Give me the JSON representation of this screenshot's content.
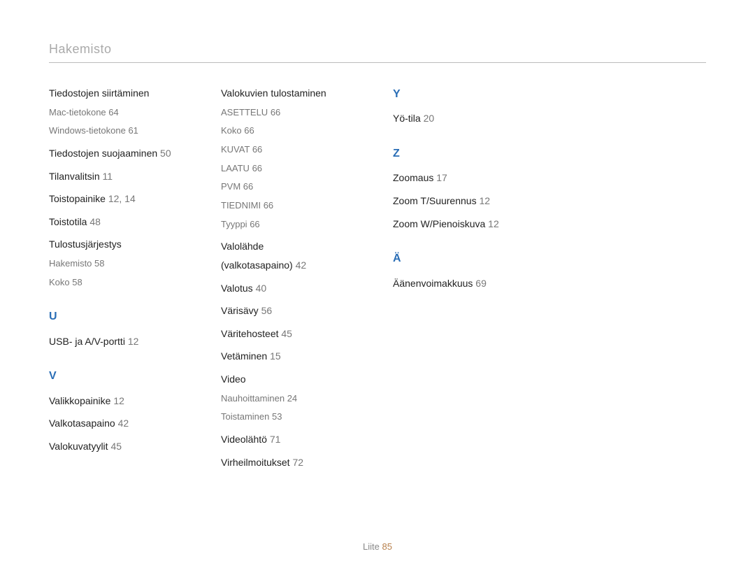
{
  "page_title": "Hakemisto",
  "footer": {
    "label": "Liite",
    "page": "85"
  },
  "col1": {
    "sec1": {
      "head": "Tiedostojen siirtäminen",
      "sub1": {
        "t": "Mac-tietokone",
        "p": "64"
      },
      "sub2": {
        "t": "Windows-tietokone",
        "p": "61"
      }
    },
    "e1": {
      "t": "Tiedostojen suojaaminen",
      "p": "50"
    },
    "e2": {
      "t": "Tilanvalitsin",
      "p": "11"
    },
    "e3": {
      "t": "Toistopainike",
      "p": "12, 14"
    },
    "e4": {
      "t": "Toistotila",
      "p": "48"
    },
    "sec2": {
      "head": "Tulostusjärjestys",
      "sub1": {
        "t": "Hakemisto",
        "p": "58"
      },
      "sub2": {
        "t": "Koko",
        "p": "58"
      }
    },
    "U": "U",
    "u1": {
      "t": "USB- ja A/V-portti",
      "p": "12"
    },
    "V": "V",
    "v1": {
      "t": "Valikkopainike",
      "p": "12"
    },
    "v2": {
      "t": "Valkotasapaino",
      "p": "42"
    },
    "v3": {
      "t": "Valokuvatyylit",
      "p": "45"
    }
  },
  "col2": {
    "sec1": {
      "head": "Valokuvien tulostaminen",
      "s1": {
        "t": "ASETTELU",
        "p": "66"
      },
      "s2": {
        "t": "Koko",
        "p": "66"
      },
      "s3": {
        "t": "KUVAT",
        "p": "66"
      },
      "s4": {
        "t": "LAATU",
        "p": "66"
      },
      "s5": {
        "t": "PVM",
        "p": "66"
      },
      "s6": {
        "t": "TIEDNIMI",
        "p": "66"
      },
      "s7": {
        "t": "Tyyppi",
        "p": "66"
      }
    },
    "e1a": "Valolähde",
    "e1b": {
      "t": "(valkotasapaino)",
      "p": "42"
    },
    "e2": {
      "t": "Valotus",
      "p": "40"
    },
    "e3": {
      "t": "Värisävy",
      "p": "56"
    },
    "e4": {
      "t": "Väritehosteet",
      "p": "45"
    },
    "e5": {
      "t": "Vetäminen",
      "p": "15"
    },
    "sec2": {
      "head": "Video",
      "s1": {
        "t": "Nauhoittaminen",
        "p": "24"
      },
      "s2": {
        "t": "Toistaminen",
        "p": "53"
      }
    },
    "e6": {
      "t": "Videolähtö",
      "p": "71"
    },
    "e7": {
      "t": "Virheilmoitukset",
      "p": "72"
    }
  },
  "col3": {
    "Y": "Y",
    "y1": {
      "t": "Yö-tila",
      "p": "20"
    },
    "Z": "Z",
    "z1": {
      "t": "Zoomaus",
      "p": "17"
    },
    "z2": {
      "t": "Zoom T/Suurennus",
      "p": "12"
    },
    "z3": {
      "t": "Zoom W/Pienoiskuva",
      "p": "12"
    },
    "A": "Ä",
    "a1": {
      "t": "Äänenvoimakkuus",
      "p": "69"
    }
  }
}
